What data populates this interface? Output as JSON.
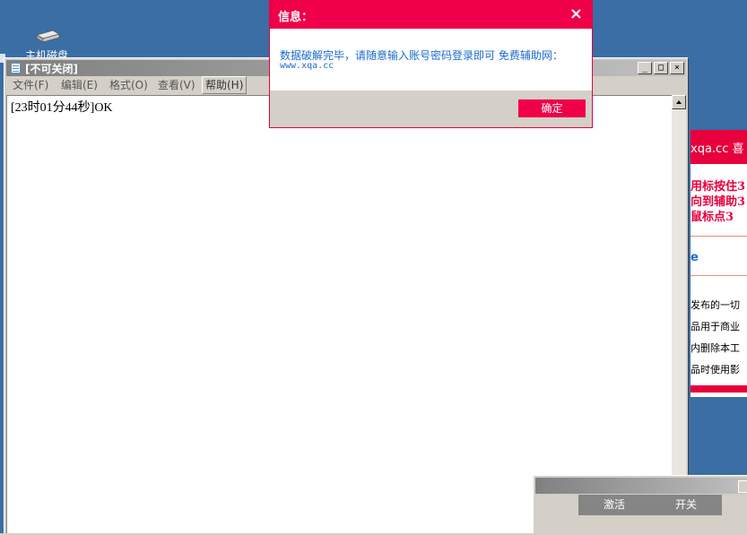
{
  "desktop": {
    "icon_label": "主机磁盘"
  },
  "notepad": {
    "title": "[不可关闭]",
    "menu": [
      {
        "label": "文件(F)"
      },
      {
        "label": "编辑(E)"
      },
      {
        "label": "格式(O)"
      },
      {
        "label": "查看(V)"
      },
      {
        "label": "帮助(H)"
      }
    ],
    "content": "[23时01分44秒]OK",
    "controls": {
      "minimize": "_",
      "maximize": "□",
      "close": "×"
    }
  },
  "web_panel": {
    "header": "xqa.cc 喜",
    "red_lines": [
      "用标按住3",
      "向到辅助3",
      "鼠标点3"
    ],
    "link_text": "e",
    "notes": [
      "发布的一切",
      "品用于商业",
      "内删除本工",
      "品时使用影"
    ]
  },
  "dialog": {
    "title": "信息：",
    "close_glyph": "×",
    "message": "数据破解完毕，请随意输入账号密码登录即可  免费辅助网：",
    "url": "www.xqa.cc",
    "ok_label": "确定"
  },
  "mini_window": {
    "activate_label": "激活",
    "switch_label": "开关"
  },
  "colors": {
    "desktop": "#3a6ea5",
    "accent_red": "#ef0048",
    "link_blue": "#1c6bd0"
  }
}
